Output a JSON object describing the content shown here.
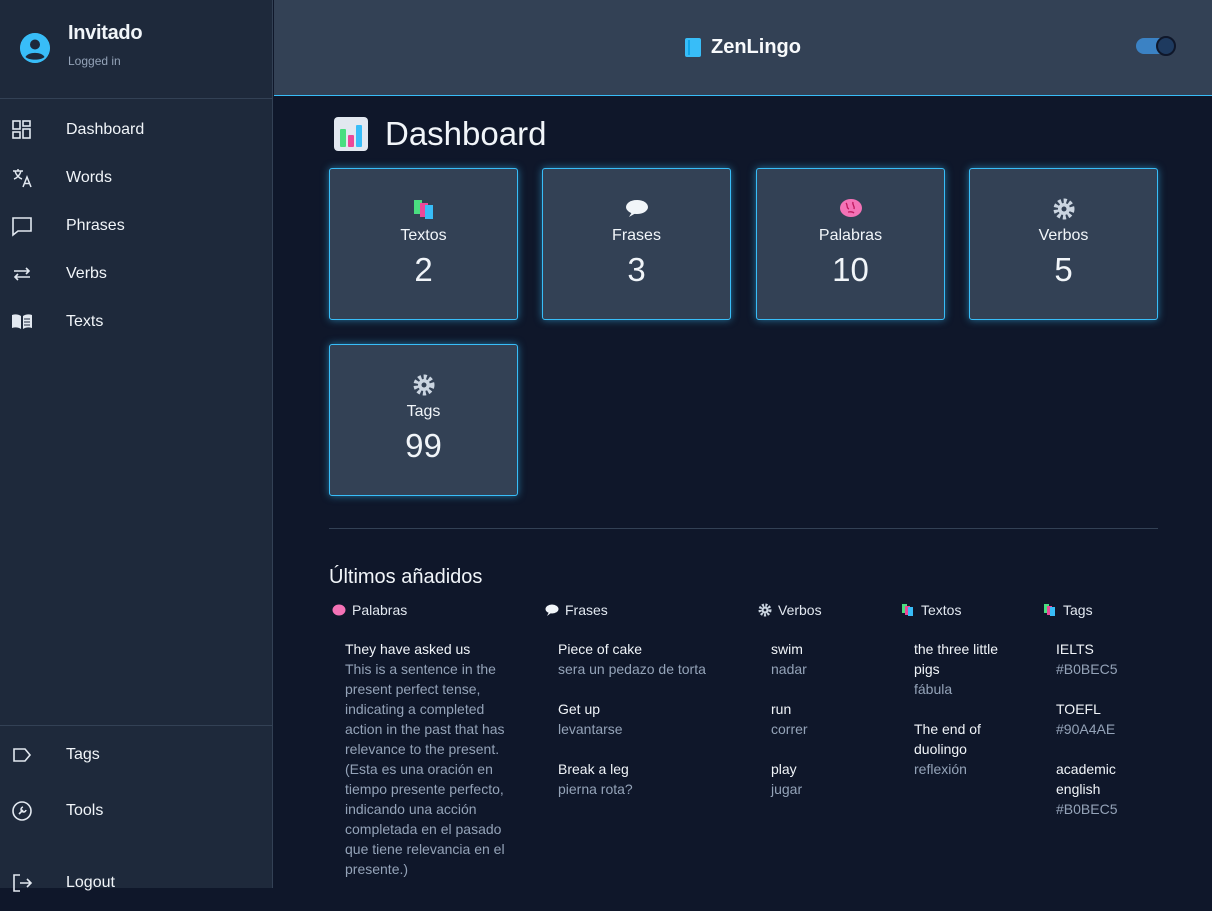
{
  "user": {
    "name": "Invitado",
    "status": "Logged in"
  },
  "nav": {
    "top": [
      {
        "label": "Dashboard",
        "icon": "dashboard-icon"
      },
      {
        "label": "Words",
        "icon": "translate-icon"
      },
      {
        "label": "Phrases",
        "icon": "chat-icon"
      },
      {
        "label": "Verbs",
        "icon": "repeat-icon"
      },
      {
        "label": "Texts",
        "icon": "book-icon"
      }
    ],
    "bottom": [
      {
        "label": "Tags",
        "icon": "tag-icon"
      },
      {
        "label": "Tools",
        "icon": "wrench-icon"
      },
      {
        "label": "Logout",
        "icon": "logout-icon"
      }
    ]
  },
  "header": {
    "brand": "ZenLingo",
    "brand_icon": "blue-book-icon"
  },
  "page": {
    "title": "Dashboard",
    "title_icon": "bar-chart-icon"
  },
  "stats": [
    {
      "label": "Textos",
      "value": "2",
      "icon": "books-icon"
    },
    {
      "label": "Frases",
      "value": "3",
      "icon": "speech-bubble-icon"
    },
    {
      "label": "Palabras",
      "value": "10",
      "icon": "brain-icon"
    },
    {
      "label": "Verbos",
      "value": "5",
      "icon": "gear-icon"
    },
    {
      "label": "Tags",
      "value": "99",
      "icon": "gear-icon"
    }
  ],
  "recent": {
    "title": "Últimos añadidos",
    "palabras": {
      "heading": "Palabras",
      "items": [
        {
          "title": "They have asked us",
          "sub": "This is a sentence in the present perfect tense, indicating a completed action in the past that has relevance to the present. (Esta es una oración en tiempo presente perfecto, indicando una acción completada en el pasado que tiene relevancia en el presente.)"
        }
      ]
    },
    "frases": {
      "heading": "Frases",
      "items": [
        {
          "title": "Piece of cake",
          "sub": "sera un pedazo de torta"
        },
        {
          "title": "Get up",
          "sub": "levantarse"
        },
        {
          "title": "Break a leg",
          "sub": "pierna rota?"
        }
      ]
    },
    "verbos": {
      "heading": "Verbos",
      "items": [
        {
          "title": "swim",
          "sub": "nadar"
        },
        {
          "title": "run",
          "sub": "correr"
        },
        {
          "title": "play",
          "sub": "jugar"
        }
      ]
    },
    "textos": {
      "heading": "Textos",
      "items": [
        {
          "title": "the three little pigs",
          "sub": "fábula"
        },
        {
          "title": "The end of duolingo",
          "sub": "reflexión"
        }
      ]
    },
    "tags": {
      "heading": "Tags",
      "items": [
        {
          "title": "IELTS",
          "sub": "#B0BEC5"
        },
        {
          "title": "TOEFL",
          "sub": "#90A4AE"
        },
        {
          "title": "academic english",
          "sub": "#B0BEC5"
        }
      ]
    }
  },
  "colors": {
    "accent": "#38bdf8",
    "background": "#0f172a",
    "panel": "#1e293b",
    "card": "#334155"
  }
}
